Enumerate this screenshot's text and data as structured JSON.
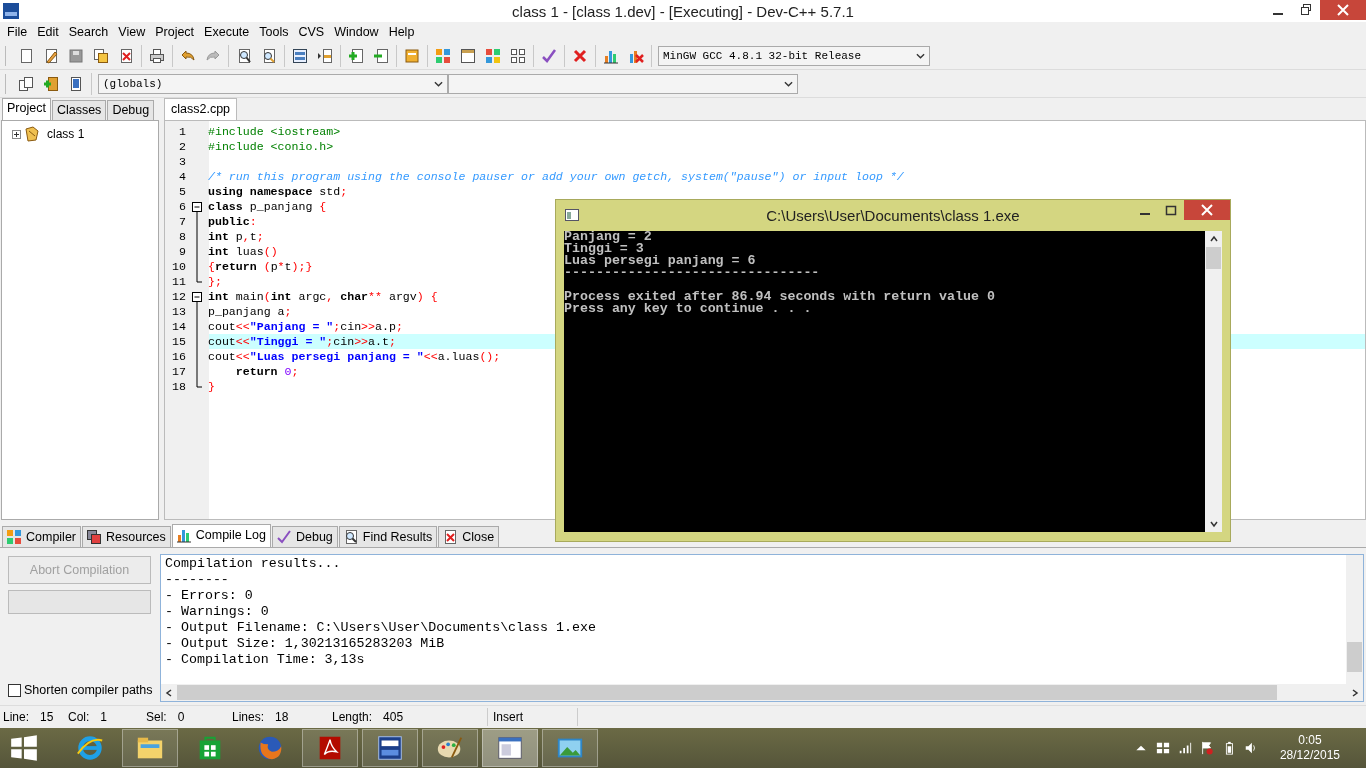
{
  "window": {
    "title": "class 1 - [class 1.dev] - [Executing] - Dev-C++ 5.7.1"
  },
  "menu": [
    "File",
    "Edit",
    "Search",
    "View",
    "Project",
    "Execute",
    "Tools",
    "CVS",
    "Window",
    "Help"
  ],
  "toolbar": {
    "compiler": "MinGW GCC 4.8.1 32-bit Release",
    "scope": "(globals)"
  },
  "left_panel": {
    "tabs": [
      {
        "label": "Project",
        "selected": true
      },
      {
        "label": "Classes",
        "selected": false
      },
      {
        "label": "Debug",
        "selected": false
      }
    ],
    "tree": [
      {
        "label": "class 1",
        "expanded": false
      }
    ]
  },
  "editor": {
    "tabs": [
      {
        "label": "class2.cpp",
        "selected": true
      }
    ],
    "lines": [
      {
        "number": "1",
        "current": false,
        "tokens": [
          {
            "kind": "preprocessor",
            "text": "#include <iostream>"
          }
        ]
      },
      {
        "number": "2",
        "current": false,
        "tokens": [
          {
            "kind": "preprocessor",
            "text": "#include <conio.h>"
          }
        ]
      },
      {
        "number": "3",
        "current": false
      },
      {
        "number": "4",
        "current": false,
        "tokens": [
          {
            "kind": "comment",
            "text": "/* run this program using the console pauser or add your own getch, system(\"pause\") or input loop */"
          }
        ]
      },
      {
        "number": "5",
        "current": false,
        "tokens": [
          {
            "kind": "keyword",
            "text": "using namespace"
          },
          {
            "kind": "plain",
            "text": " std"
          },
          {
            "kind": "symbol",
            "text": ";"
          }
        ]
      },
      {
        "number": "6",
        "current": false,
        "fold_marker": {
          "kind": "open"
        },
        "tokens": [
          {
            "kind": "keyword",
            "text": "class"
          },
          {
            "kind": "plain",
            "text": " p_panjang "
          },
          {
            "kind": "symbol",
            "text": "{"
          }
        ]
      },
      {
        "number": "7",
        "current": false,
        "fold_marker": {
          "kind": "line"
        },
        "tokens": [
          {
            "kind": "keyword",
            "text": "public"
          },
          {
            "kind": "symbol",
            "text": ":"
          }
        ]
      },
      {
        "number": "8",
        "current": false,
        "fold_marker": {
          "kind": "line"
        },
        "tokens": [
          {
            "kind": "keyword",
            "text": "int"
          },
          {
            "kind": "plain",
            "text": " p"
          },
          {
            "kind": "symbol",
            "text": ","
          },
          {
            "kind": "plain",
            "text": "t"
          },
          {
            "kind": "symbol",
            "text": ";"
          }
        ]
      },
      {
        "number": "9",
        "current": false,
        "fold_marker": {
          "kind": "line"
        },
        "tokens": [
          {
            "kind": "keyword",
            "text": "int"
          },
          {
            "kind": "plain",
            "text": " luas"
          },
          {
            "kind": "symbol",
            "text": "()"
          }
        ]
      },
      {
        "number": "10",
        "current": false,
        "fold_marker": {
          "kind": "line"
        },
        "tokens": [
          {
            "kind": "symbol",
            "text": "{"
          },
          {
            "kind": "keyword",
            "text": "return"
          },
          {
            "kind": "symbol",
            "text": " ("
          },
          {
            "kind": "plain",
            "text": "p"
          },
          {
            "kind": "symbol",
            "text": "*"
          },
          {
            "kind": "plain",
            "text": "t"
          },
          {
            "kind": "symbol",
            "text": ");}"
          }
        ]
      },
      {
        "number": "11",
        "current": false,
        "fold_marker": {
          "kind": "end"
        },
        "tokens": [
          {
            "kind": "symbol",
            "text": "};"
          }
        ]
      },
      {
        "number": "12",
        "current": false,
        "fold_marker": {
          "kind": "open"
        },
        "tokens": [
          {
            "kind": "keyword",
            "text": "int"
          },
          {
            "kind": "plain",
            "text": " main"
          },
          {
            "kind": "symbol",
            "text": "("
          },
          {
            "kind": "keyword",
            "text": "int"
          },
          {
            "kind": "plain",
            "text": " argc"
          },
          {
            "kind": "symbol",
            "text": ", "
          },
          {
            "kind": "keyword",
            "text": "char"
          },
          {
            "kind": "symbol",
            "text": "**"
          },
          {
            "kind": "plain",
            "text": " argv"
          },
          {
            "kind": "symbol",
            "text": ") {"
          }
        ]
      },
      {
        "number": "13",
        "current": false,
        "fold_marker": {
          "kind": "line"
        },
        "tokens": [
          {
            "kind": "plain",
            "text": "p_panjang a"
          },
          {
            "kind": "symbol",
            "text": ";"
          }
        ]
      },
      {
        "number": "14",
        "current": false,
        "fold_marker": {
          "kind": "line"
        },
        "tokens": [
          {
            "kind": "plain",
            "text": "cout"
          },
          {
            "kind": "symbol",
            "text": "<<"
          },
          {
            "kind": "string",
            "text": "\"Panjang = \""
          },
          {
            "kind": "symbol",
            "text": ";"
          },
          {
            "kind": "plain",
            "text": "cin"
          },
          {
            "kind": "symbol",
            "text": ">>"
          },
          {
            "kind": "plain",
            "text": "a.p"
          },
          {
            "kind": "symbol",
            "text": ";"
          }
        ]
      },
      {
        "number": "15",
        "current": true,
        "fold_marker": {
          "kind": "line"
        },
        "tokens": [
          {
            "kind": "plain",
            "text": "cout"
          },
          {
            "kind": "symbol",
            "text": "<<"
          },
          {
            "kind": "string",
            "text": "\"Tinggi = \""
          },
          {
            "kind": "symbol",
            "text": ";"
          },
          {
            "kind": "plain",
            "text": "cin"
          },
          {
            "kind": "symbol",
            "text": ">>"
          },
          {
            "kind": "plain",
            "text": "a.t"
          },
          {
            "kind": "symbol",
            "text": ";"
          }
        ]
      },
      {
        "number": "16",
        "current": false,
        "fold_marker": {
          "kind": "line"
        },
        "tokens": [
          {
            "kind": "plain",
            "text": "cout"
          },
          {
            "kind": "symbol",
            "text": "<<"
          },
          {
            "kind": "string",
            "text": "\"Luas persegi panjang = \""
          },
          {
            "kind": "symbol",
            "text": "<<"
          },
          {
            "kind": "plain",
            "text": "a.luas"
          },
          {
            "kind": "symbol",
            "text": "();"
          }
        ]
      },
      {
        "number": "17",
        "current": false,
        "fold_marker": {
          "kind": "line"
        },
        "tokens": [
          {
            "kind": "keyword",
            "text": "    return"
          },
          {
            "kind": "number",
            "text": " 0"
          },
          {
            "kind": "symbol",
            "text": ";"
          }
        ]
      },
      {
        "number": "18",
        "current": false,
        "fold_marker": {
          "kind": "end"
        },
        "tokens": [
          {
            "kind": "symbol",
            "text": "}"
          }
        ]
      }
    ]
  },
  "console": {
    "title": "C:\\Users\\User\\Documents\\class 1.exe",
    "blocks": [
      [
        "Panjang = 2",
        "Tinggi = 3",
        "Luas persegi panjang = 6",
        "--------------------------------"
      ],
      [
        "Process exited after 86.94 seconds with return value 0",
        "Press any key to continue . . ."
      ]
    ]
  },
  "bottom_panel": {
    "tabs": [
      {
        "label": "Compiler",
        "selected": false
      },
      {
        "label": "Resources",
        "selected": false
      },
      {
        "label": "Compile Log",
        "selected": true
      },
      {
        "label": "Debug",
        "selected": false
      },
      {
        "label": "Find Results",
        "selected": false
      },
      {
        "label": "Close",
        "selected": false
      }
    ],
    "abort_button": {
      "label": "Abort Compilation",
      "disabled": true
    },
    "progress": {
      "level": 0
    },
    "shorten_paths": {
      "label": "Shorten compiler paths",
      "checked": false
    },
    "log": [
      "Compilation results...",
      "--------",
      "- Errors: 0",
      "- Warnings: 0",
      "- Output Filename: C:\\Users\\User\\Documents\\class 1.exe",
      "- Output Size: 1,30213165283203 MiB",
      "- Compilation Time: 3,13s"
    ]
  },
  "status_bar": [
    {
      "label": "Line:",
      "value": "15"
    },
    {
      "label": "Col:",
      "value": "1"
    },
    {
      "label": "Sel:",
      "value": "0"
    },
    {
      "label": "Lines:",
      "value": "18"
    },
    {
      "label": "Length:",
      "value": "405"
    },
    {
      "label": "Insert"
    }
  ],
  "taskbar": {
    "time": "0:05",
    "date": "28/12/2015"
  }
}
